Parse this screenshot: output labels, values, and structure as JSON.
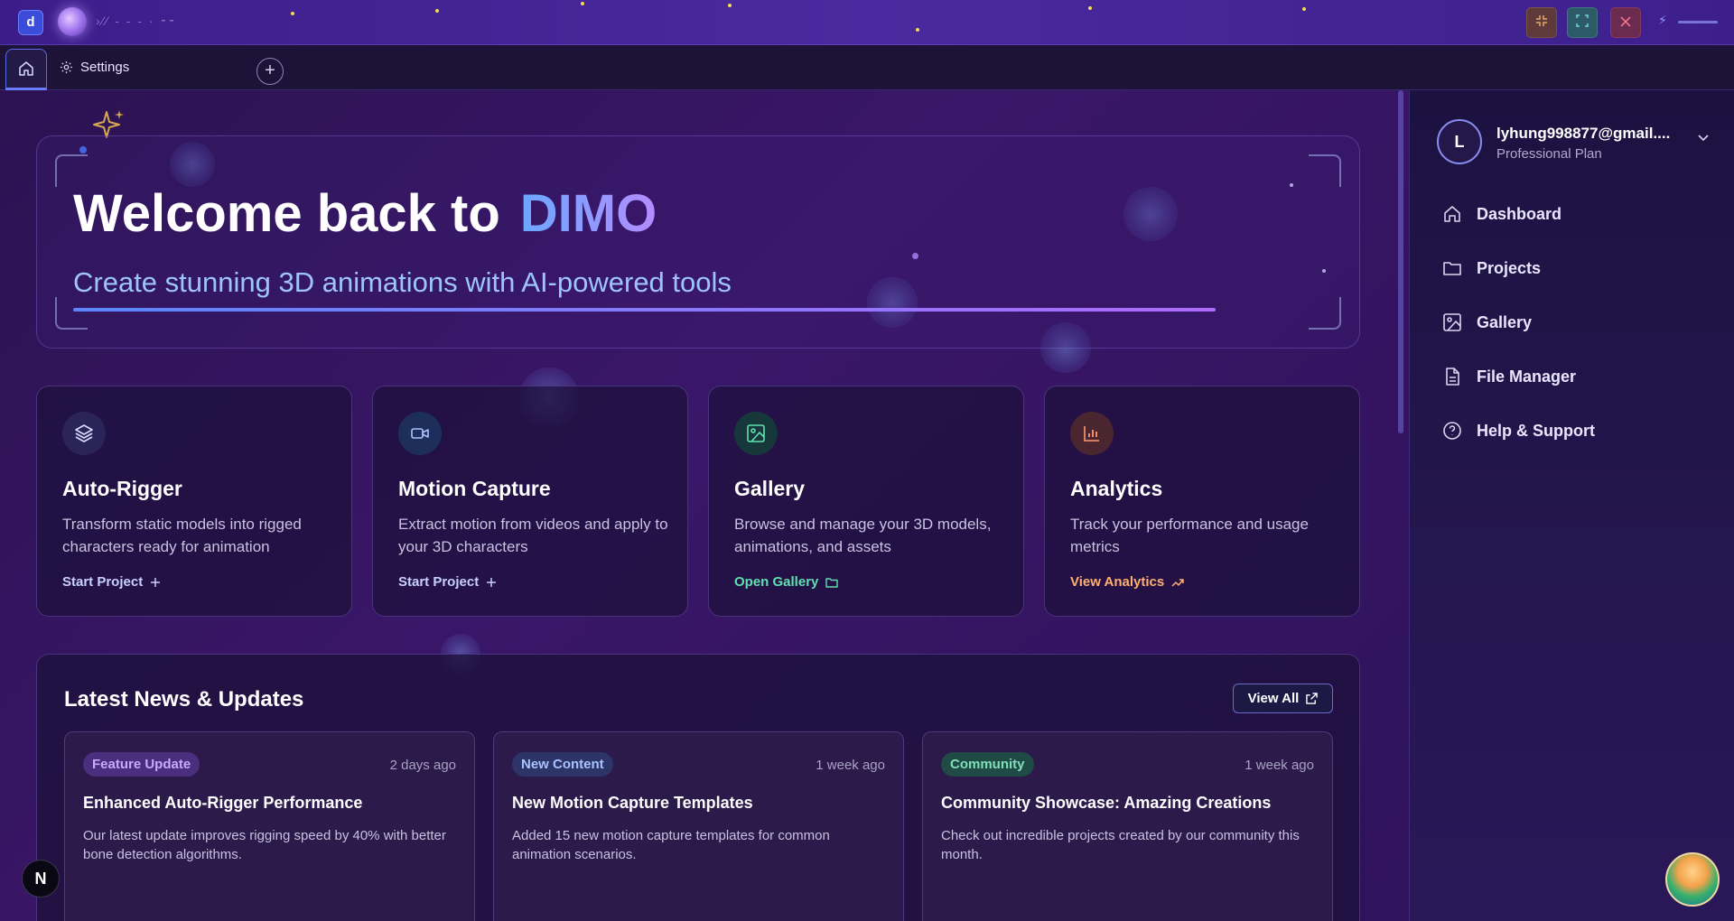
{
  "titlebar": {
    "app_icon": "d",
    "window_buttons": {
      "minimize_icon": "shrink-icon",
      "maximize_icon": "maximize-icon",
      "close_icon": "close-icon"
    }
  },
  "tabs": {
    "home_icon": "home-icon",
    "settings_label": "Settings",
    "add_label": "+"
  },
  "hero": {
    "title": "Welcome back to",
    "brand": "DIMO",
    "subtitle": "Create stunning 3D animations with AI-powered tools"
  },
  "features": [
    {
      "title": "Auto-Rigger",
      "desc": "Transform static models into rigged characters ready for animation",
      "link": "Start Project",
      "icon": "layers-icon",
      "link_icon": "plus-icon",
      "accent": "#c8d0ff"
    },
    {
      "title": "Motion Capture",
      "desc": "Extract motion from videos and apply to your 3D characters",
      "link": "Start Project",
      "icon": "video-icon",
      "link_icon": "plus-icon",
      "accent": "#c8d0ff"
    },
    {
      "title": "Gallery",
      "desc": "Browse and manage your 3D models, animations, and assets",
      "link": "Open Gallery",
      "icon": "image-icon",
      "link_icon": "folder-icon",
      "accent": "#5fe0b0"
    },
    {
      "title": "Analytics",
      "desc": "Track your performance and usage metrics",
      "link": "View Analytics",
      "icon": "chart-icon",
      "link_icon": "trend-up-icon",
      "accent": "#ffb070"
    }
  ],
  "news": {
    "title": "Latest News & Updates",
    "view_all": "View All",
    "items": [
      {
        "badge": "Feature Update",
        "time": "2 days ago",
        "headline": "Enhanced Auto-Rigger Performance",
        "body": "Our latest update improves rigging speed by 40% with better bone detection algorithms.",
        "badge_color": "#c9a8ff"
      },
      {
        "badge": "New Content",
        "time": "1 week ago",
        "headline": "New Motion Capture Templates",
        "body": "Added 15 new motion capture templates for common animation scenarios.",
        "badge_color": "#a8c4ff"
      },
      {
        "badge": "Community",
        "time": "1 week ago",
        "headline": "Community Showcase: Amazing Creations",
        "body": "Check out incredible projects created by our community this month.",
        "badge_color": "#7fe0b8"
      }
    ]
  },
  "sidebar": {
    "avatar_initial": "L",
    "email": "lyhung998877@gmail....",
    "plan": "Professional Plan",
    "nav": [
      {
        "label": "Dashboard",
        "icon": "home-icon"
      },
      {
        "label": "Projects",
        "icon": "folder-icon"
      },
      {
        "label": "Gallery",
        "icon": "image-icon"
      },
      {
        "label": "File Manager",
        "icon": "file-icon"
      },
      {
        "label": "Help & Support",
        "icon": "help-circle-icon"
      }
    ]
  },
  "floating": {
    "n_badge": "N"
  }
}
